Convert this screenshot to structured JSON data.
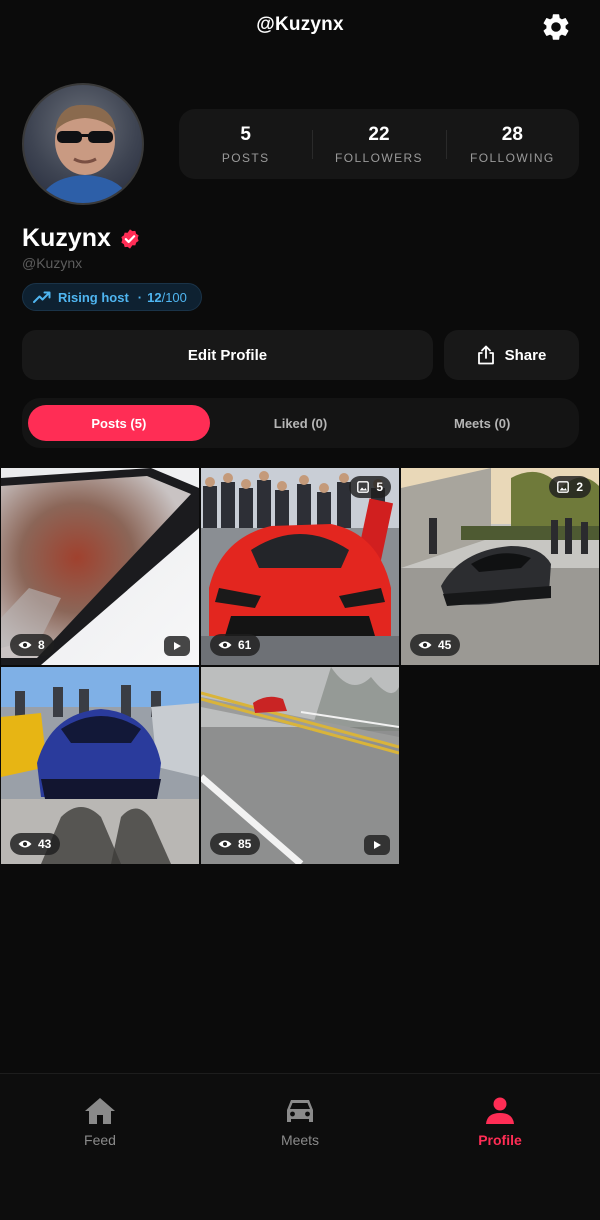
{
  "header": {
    "handle": "@Kuzynx"
  },
  "profile": {
    "display_name": "Kuzynx",
    "username": "@Kuzynx",
    "stats": [
      {
        "value": "5",
        "label": "POSTS"
      },
      {
        "value": "22",
        "label": "FOLLOWERS"
      },
      {
        "value": "28",
        "label": "FOLLOWING"
      }
    ],
    "host_badge": {
      "label": "Rising host",
      "score": "12",
      "score_max": "/100"
    }
  },
  "actions": {
    "edit_label": "Edit Profile",
    "share_label": "Share"
  },
  "tabs": [
    {
      "label": "Posts (5)",
      "active": true
    },
    {
      "label": "Liked (0)",
      "active": false
    },
    {
      "label": "Meets (0)",
      "active": false
    }
  ],
  "posts": [
    {
      "views": "8",
      "type": "video"
    },
    {
      "views": "61",
      "type": "carousel",
      "count": "5"
    },
    {
      "views": "45",
      "type": "carousel",
      "count": "2"
    },
    {
      "views": "43",
      "type": "photo"
    },
    {
      "views": "85",
      "type": "video"
    }
  ],
  "nav": [
    {
      "label": "Feed",
      "icon": "home-icon"
    },
    {
      "label": "Meets",
      "icon": "car-icon"
    },
    {
      "label": "Profile",
      "icon": "person-icon",
      "active": true
    }
  ],
  "colors": {
    "accent": "#ff2d55",
    "badge_blue": "#4fb5f0",
    "verified": "#ff2d55"
  }
}
